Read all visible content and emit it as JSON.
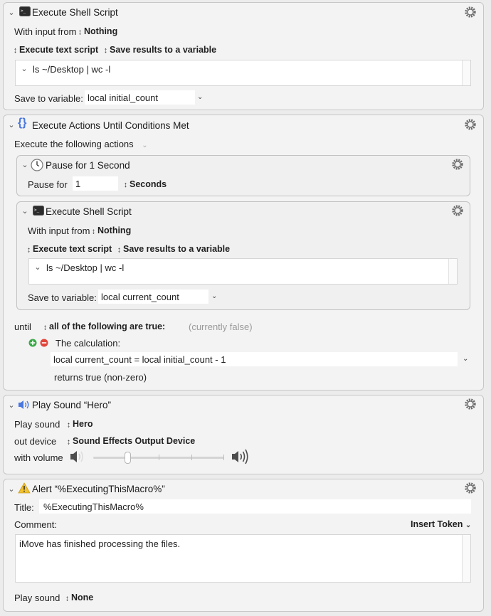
{
  "shell1": {
    "title": "Execute Shell Script",
    "input_label": "With input from",
    "input_value": "Nothing",
    "mode": "Execute text script",
    "save_mode": "Save results to a variable",
    "script": "ls ~/Desktop | wc -l",
    "save_label": "Save to variable:",
    "save_value": "local initial_count"
  },
  "until_loop": {
    "title": "Execute Actions Until Conditions Met",
    "execute_label": "Execute the following actions",
    "pause": {
      "title": "Pause for 1 Second",
      "label": "Pause for",
      "value": "1",
      "unit": "Seconds"
    },
    "shell2": {
      "title": "Execute Shell Script",
      "input_label": "With input from",
      "input_value": "Nothing",
      "mode": "Execute text script",
      "save_mode": "Save results to a variable",
      "script": "ls ~/Desktop | wc -l",
      "save_label": "Save to variable:",
      "save_value": "local current_count"
    },
    "until_label": "until",
    "condition_mode": "all of the following are true:",
    "status": "(currently false)",
    "calc_label": "The calculation:",
    "calc_value": "local current_count = local initial_count - 1",
    "returns": "returns true (non-zero)"
  },
  "sound": {
    "title": "Play Sound “Hero”",
    "play_label": "Play sound",
    "play_value": "Hero",
    "device_label": "out device",
    "device_value": "Sound Effects Output Device",
    "volume_label": "with volume",
    "volume_level": 0.25
  },
  "alert": {
    "title": "Alert “%ExecutingThisMacro%”",
    "title_label": "Title:",
    "title_value": "%ExecutingThisMacro%",
    "comment_label": "Comment:",
    "insert_token": "Insert Token",
    "comment_value": "iMove has finished processing the files.",
    "play_label": "Play sound",
    "play_value": "None"
  },
  "icons": {
    "terminal": "terminal-icon",
    "loop": "curly-braces-icon",
    "clock": "clock-icon",
    "speaker": "speaker-icon",
    "warning": "warning-icon",
    "gear": "gear-icon",
    "add": "add-condition-icon",
    "remove": "remove-condition-icon"
  },
  "colors": {
    "accent_blue": "#4a78e0",
    "add_green": "#3aa847",
    "remove_red": "#e0443a",
    "warning_yellow": "#f2c12e"
  }
}
